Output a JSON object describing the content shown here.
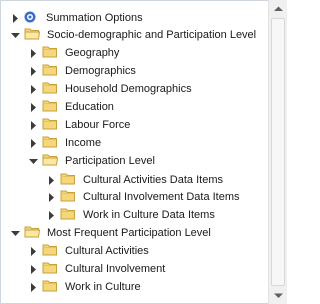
{
  "tree": {
    "items": [
      {
        "label": "Summation Options",
        "icon": "summation-icon",
        "state": "collapsed"
      },
      {
        "label": "Socio-demographic and Participation Level",
        "icon": "folder-open-icon",
        "state": "expanded"
      },
      {
        "label": "Geography",
        "icon": "folder-icon",
        "state": "collapsed"
      },
      {
        "label": "Demographics",
        "icon": "folder-icon",
        "state": "collapsed"
      },
      {
        "label": "Household Demographics",
        "icon": "folder-icon",
        "state": "collapsed"
      },
      {
        "label": "Education",
        "icon": "folder-icon",
        "state": "collapsed"
      },
      {
        "label": "Labour Force",
        "icon": "folder-icon",
        "state": "collapsed"
      },
      {
        "label": "Income",
        "icon": "folder-icon",
        "state": "collapsed"
      },
      {
        "label": "Participation Level",
        "icon": "folder-open-icon",
        "state": "expanded"
      },
      {
        "label": "Cultural Activities Data Items",
        "icon": "folder-icon",
        "state": "collapsed"
      },
      {
        "label": "Cultural Involvement Data Items",
        "icon": "folder-icon",
        "state": "collapsed"
      },
      {
        "label": "Work in Culture Data Items",
        "icon": "folder-icon",
        "state": "collapsed"
      },
      {
        "label": "Most Frequent Participation Level",
        "icon": "folder-open-icon",
        "state": "expanded"
      },
      {
        "label": "Cultural Activities",
        "icon": "folder-icon",
        "state": "collapsed"
      },
      {
        "label": "Cultural Involvement",
        "icon": "folder-icon",
        "state": "collapsed"
      },
      {
        "label": "Work in Culture",
        "icon": "folder-icon",
        "state": "collapsed"
      }
    ]
  },
  "colors": {
    "folder_fill": "#f5d77b",
    "folder_edge": "#c9a13a",
    "summation_blue": "#3a6fc9"
  }
}
